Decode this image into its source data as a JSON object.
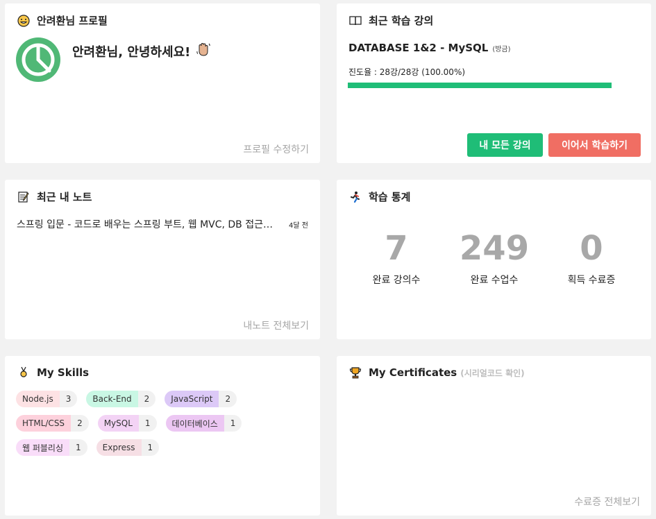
{
  "profile": {
    "title": "안려환님 프로필",
    "greeting": "안려환님, 안녕하세요!",
    "edit_link": "프로필 수정하기"
  },
  "recent_course": {
    "title": "최근 학습 강의",
    "course_name": "DATABASE 1&2 - MySQL",
    "course_tag": "(방금)",
    "progress_text": "진도율 : 28강/28강 (100.00%)",
    "progress_percent": 100,
    "btn_all": "내 모든 강의",
    "btn_continue": "이어서 학습하기"
  },
  "notes": {
    "title": "최근 내 노트",
    "items": [
      {
        "title": "스프링 입문 - 코드로 배우는 스프링 부트, 웹 MVC, DB 접근 기술",
        "time": "4달 전"
      }
    ],
    "view_all": "내노트 전체보기"
  },
  "stats": {
    "title": "학습 통계",
    "items": [
      {
        "value": "7",
        "label": "완료 강의수"
      },
      {
        "value": "249",
        "label": "완료 수업수"
      },
      {
        "value": "0",
        "label": "획득 수료증"
      }
    ]
  },
  "skills": {
    "title": "My Skills",
    "rows": [
      [
        {
          "name": "Node.js",
          "count": "3",
          "color": "#fde2e4"
        },
        {
          "name": "Back-End",
          "count": "2",
          "color": "#c9f7e4"
        },
        {
          "name": "JavaScript",
          "count": "2",
          "color": "#dcc9f7"
        }
      ],
      [
        {
          "name": "HTML/CSS",
          "count": "2",
          "color": "#fdd1dc"
        },
        {
          "name": "MySQL",
          "count": "1",
          "color": "#f3d3f5"
        },
        {
          "name": "데이터베이스",
          "count": "1",
          "color": "#ecc7f3"
        }
      ],
      [
        {
          "name": "웹 퍼블리싱",
          "count": "1",
          "color": "#f9ddf9"
        },
        {
          "name": "Express",
          "count": "1",
          "color": "#f6dfe5"
        }
      ]
    ]
  },
  "certs": {
    "title": "My Certificates",
    "subtitle": "(시리얼코드 확인)",
    "view_all": "수료증 전체보기"
  }
}
